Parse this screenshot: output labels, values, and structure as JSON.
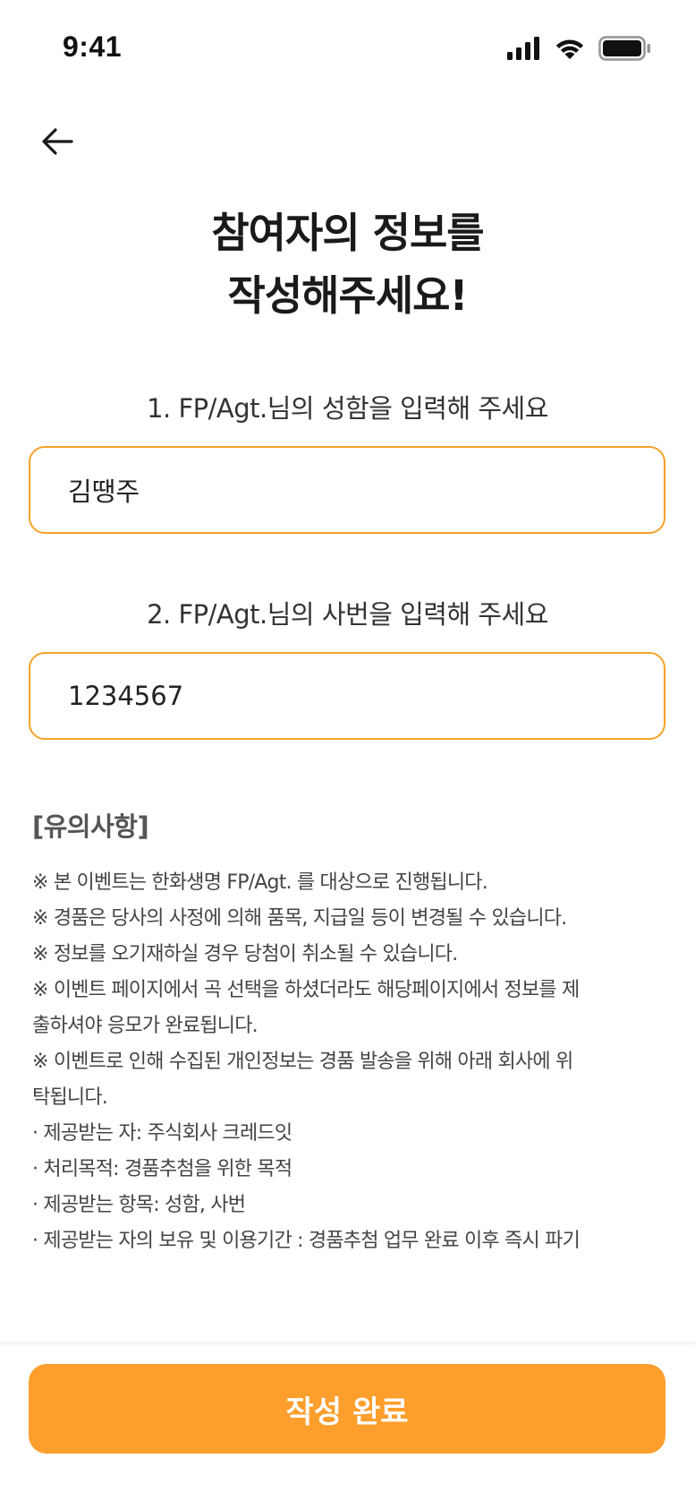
{
  "status_bar": {
    "time": "9:41",
    "icons": [
      "cellular-signal-icon",
      "wifi-icon",
      "battery-icon"
    ]
  },
  "header": {
    "back_icon": "arrow-left-icon"
  },
  "title": {
    "line1": "참여자의 정보를",
    "line2": "작성해주세요!"
  },
  "form": {
    "name_label": "1. FP/Agt.님의 성함을 입력해 주세요",
    "name_value": "김땡주",
    "id_label": "2. FP/Agt.님의 사번을 입력해 주세요",
    "id_value": "1234567"
  },
  "notice": {
    "title": "[유의사항]",
    "items": [
      "※ 본 이벤트는 한화생명 FP/Agt. 를 대상으로 진행됩니다.",
      "※ 경품은 당사의 사정에 의해 품목, 지급일 등이 변경될 수 있습니다.",
      "※ 정보를 오기재하실 경우 당첨이 취소될 수 있습니다.",
      "※ 이벤트 페이지에서 곡 선택을 하셨더라도 해당페이지에서 정보를 제",
      "출하셔야 응모가 완료됩니다.",
      "※ 이벤트로 인해 수집된 개인정보는 경품 발송을 위해 아래 회사에 위",
      "탁됩니다.",
      " · 제공받는 자: 주식회사 크레드잇",
      " · 처리목적: 경품추첨을 위한 목적",
      " · 제공받는 항목: 성함, 사번",
      " · 제공받는 자의 보유 및 이용기간 : 경품추첨 업무 완료 이후 즉시 파기"
    ]
  },
  "footer": {
    "submit_label": "작성 완료"
  },
  "colors": {
    "accent": "#fe9e2c",
    "input_border": "#f6a12a",
    "text": "#222222"
  }
}
